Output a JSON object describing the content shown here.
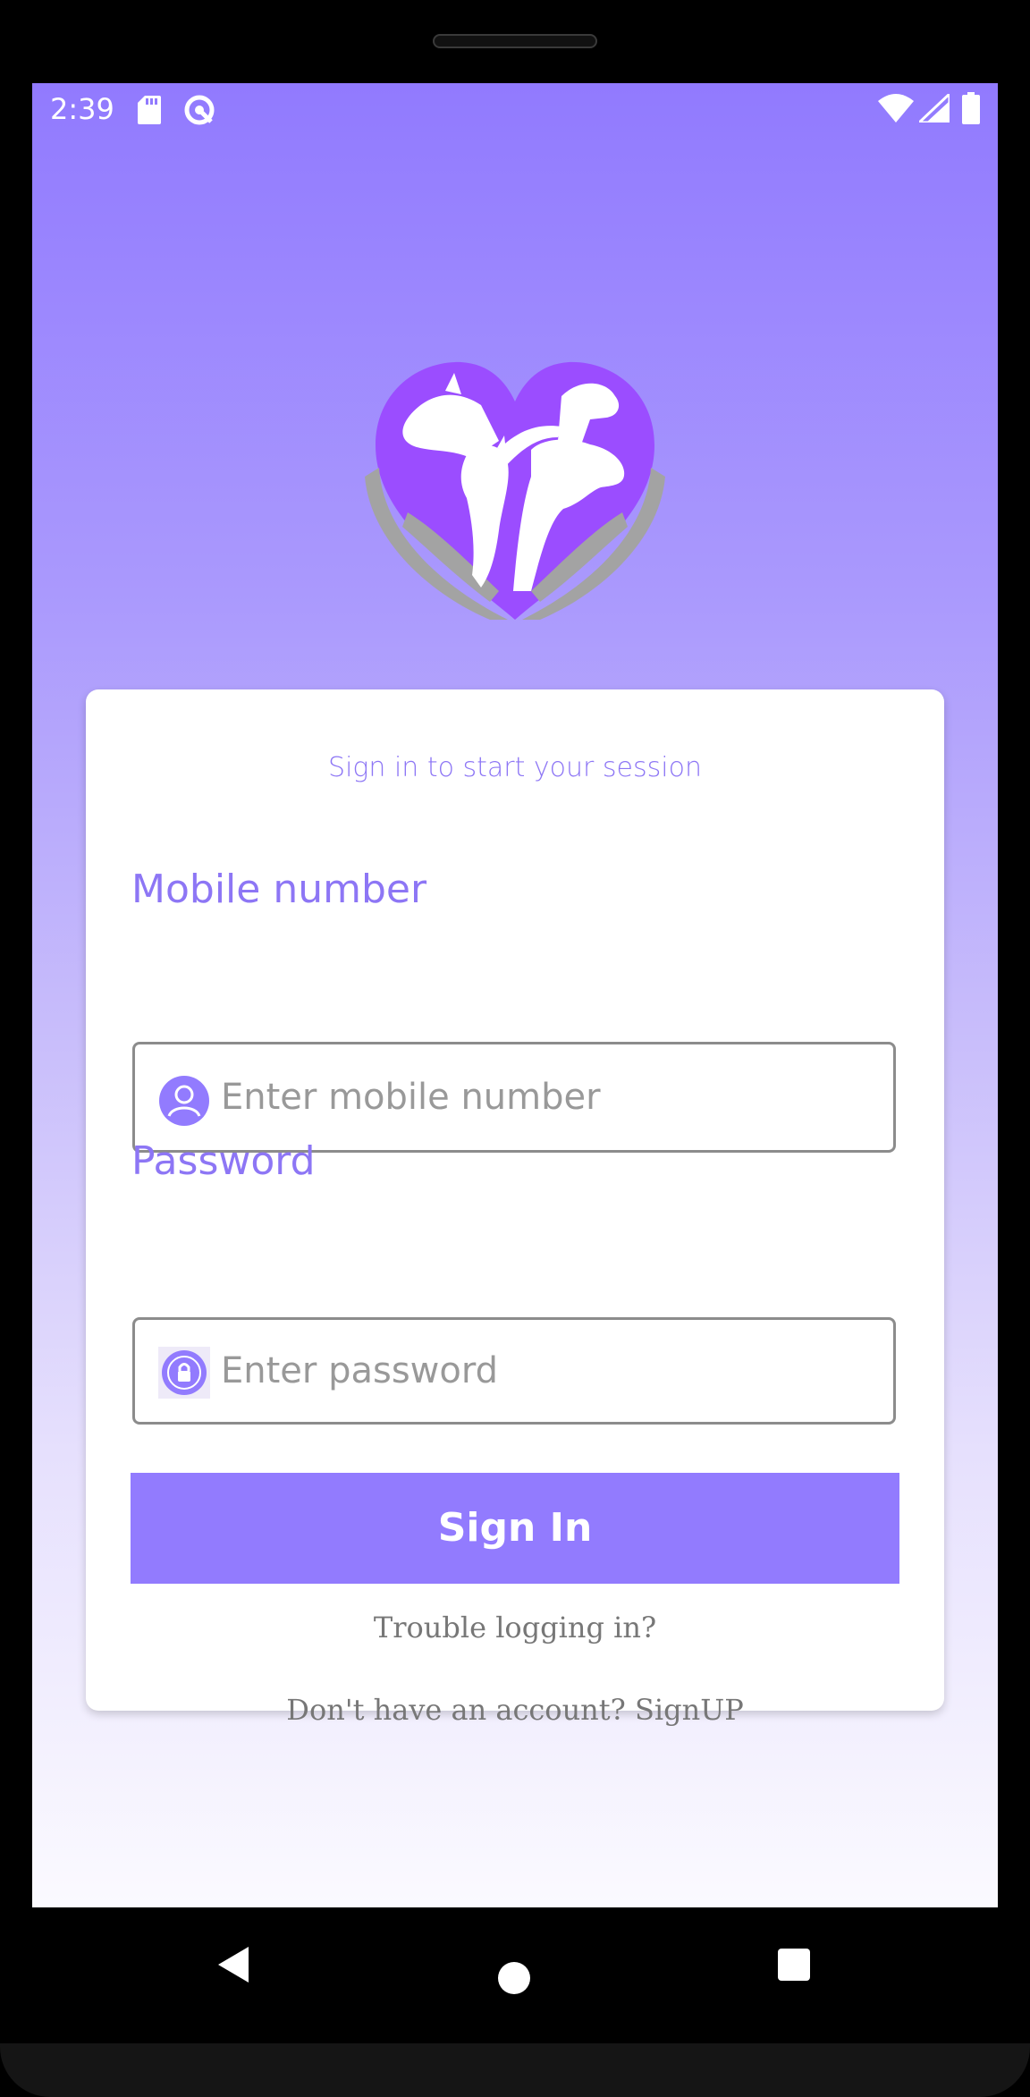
{
  "status_bar": {
    "time": "2:39",
    "icons": [
      "sd-card-icon",
      "sync-icon",
      "wifi-icon",
      "cell-signal-icon",
      "battery-icon"
    ]
  },
  "logo": {
    "icon": "pets-in-heart-hands-logo",
    "colors": {
      "heart": "#9b4dff",
      "hands": "#a3a3a3",
      "animals": "#ffffff"
    }
  },
  "login": {
    "subtitle": "Sign in to start your session",
    "mobile": {
      "label": "Mobile number",
      "placeholder": "Enter mobile number",
      "value": "",
      "icon": "user-icon"
    },
    "password": {
      "label": "Password",
      "placeholder": "Enter password",
      "value": "",
      "icon": "lock-icon"
    },
    "signin_label": "Sign In",
    "trouble_link": "Trouble logging in?",
    "signup_link": "Don't have an account? SignUP"
  },
  "nav_bar": {
    "buttons": [
      "back-icon",
      "home-icon",
      "recents-icon"
    ]
  },
  "colors": {
    "accent": "#917afe",
    "label": "#8d76f5",
    "link_text": "#777777",
    "card": "#ffffff"
  }
}
